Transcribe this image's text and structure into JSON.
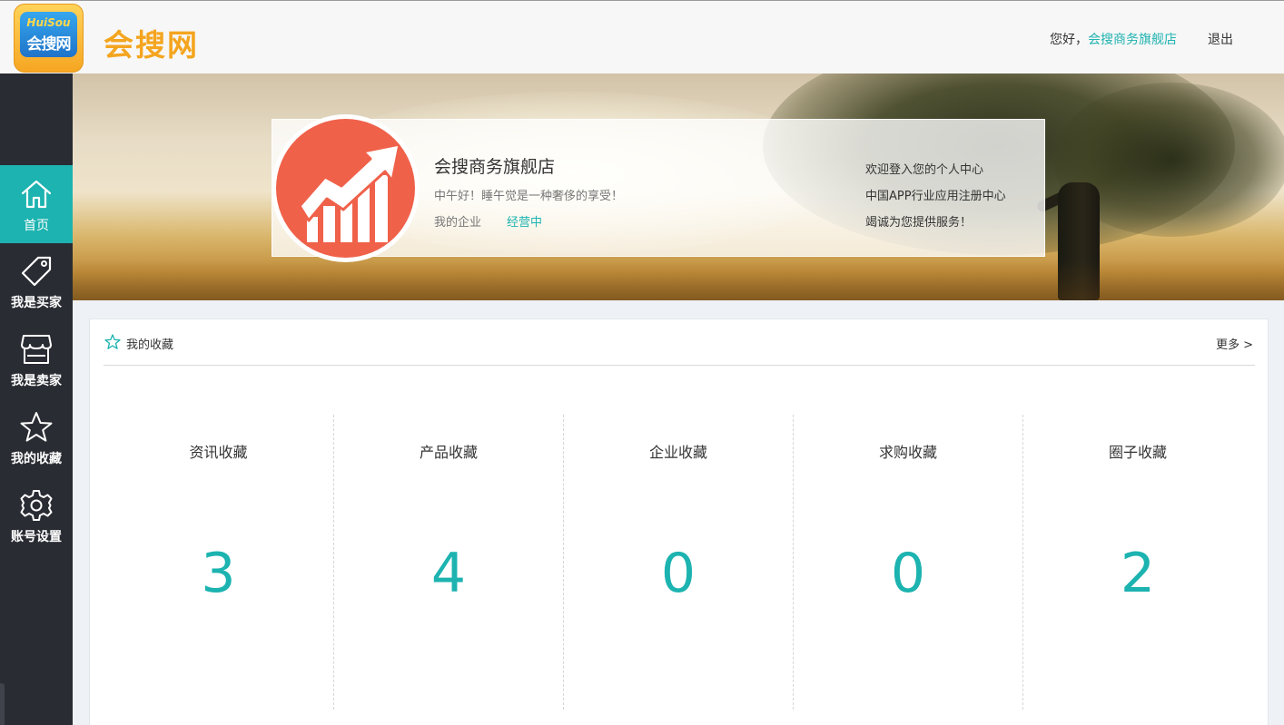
{
  "header": {
    "logo_en": "HuiSou",
    "logo_cn": "会搜网",
    "brand": "会搜网",
    "greeting_prefix": "您好，",
    "user_shop": "会搜商务旗舰店",
    "logout": "退出"
  },
  "sidebar": {
    "items": [
      {
        "label": "首页",
        "icon": "home-icon",
        "active": true
      },
      {
        "label": "我是买家",
        "icon": "tag-icon",
        "active": false
      },
      {
        "label": "我是卖家",
        "icon": "store-icon",
        "active": false
      },
      {
        "label": "我的收藏",
        "icon": "star-icon",
        "active": false
      },
      {
        "label": "账号设置",
        "icon": "gear-icon",
        "active": false
      }
    ]
  },
  "profile": {
    "shop_name": "会搜商务旗舰店",
    "motto": "中午好！睡午觉是一种奢侈的享受！",
    "enterprise_label": "我的企业",
    "enterprise_status": "经营中",
    "welcome_lines": [
      "欢迎登入您的个人中心",
      "中国APP行业应用注册中心",
      "竭诚为您提供服务！"
    ]
  },
  "favorites": {
    "title": "我的收藏",
    "more": "更多 >",
    "stats": [
      {
        "label": "资讯收藏",
        "count": "3"
      },
      {
        "label": "产品收藏",
        "count": "4"
      },
      {
        "label": "企业收藏",
        "count": "0"
      },
      {
        "label": "求购收藏",
        "count": "0"
      },
      {
        "label": "圈子收藏",
        "count": "2"
      }
    ]
  },
  "colors": {
    "accent": "#1cb3b0",
    "brand_orange": "#f4a51f",
    "sidebar_bg": "#2a2c33",
    "avatar_bg": "#f0614a"
  }
}
